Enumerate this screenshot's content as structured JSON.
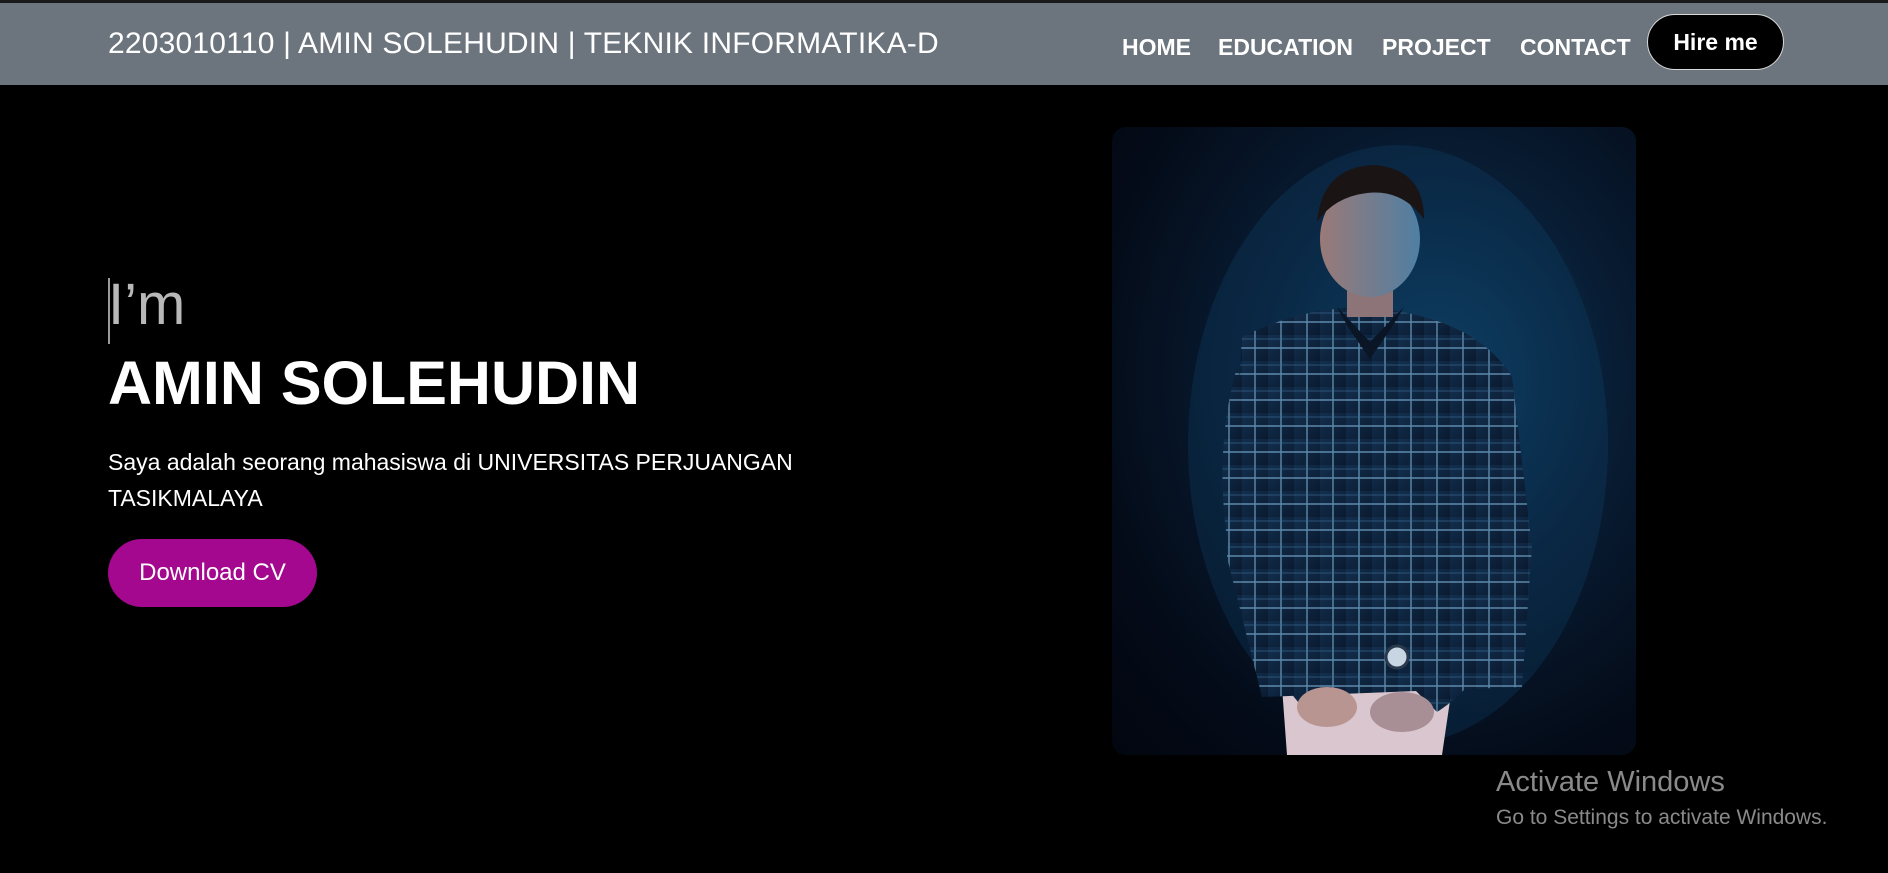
{
  "navbar": {
    "brand": "2203010110 | AMIN SOLEHUDIN | TEKNIK INFORMATIKA-D",
    "links": [
      {
        "label": "HOME"
      },
      {
        "label": "EDUCATION"
      },
      {
        "label": "PROJECT"
      },
      {
        "label": "CONTACT"
      }
    ],
    "hire_label": "Hire me"
  },
  "hero": {
    "intro": "I’m",
    "name": "AMIN SOLEHUDIN",
    "description": "Saya adalah seorang mahasiswa di UNIVERSITAS PERJUANGAN TASIKMALAYA",
    "cv_button": "Download CV"
  },
  "watermark": {
    "title": "Activate Windows",
    "subtitle": "Go to Settings to activate Windows."
  },
  "colors": {
    "navbar_bg": "#6c757d",
    "page_bg": "#000000",
    "accent": "#a3088f"
  }
}
